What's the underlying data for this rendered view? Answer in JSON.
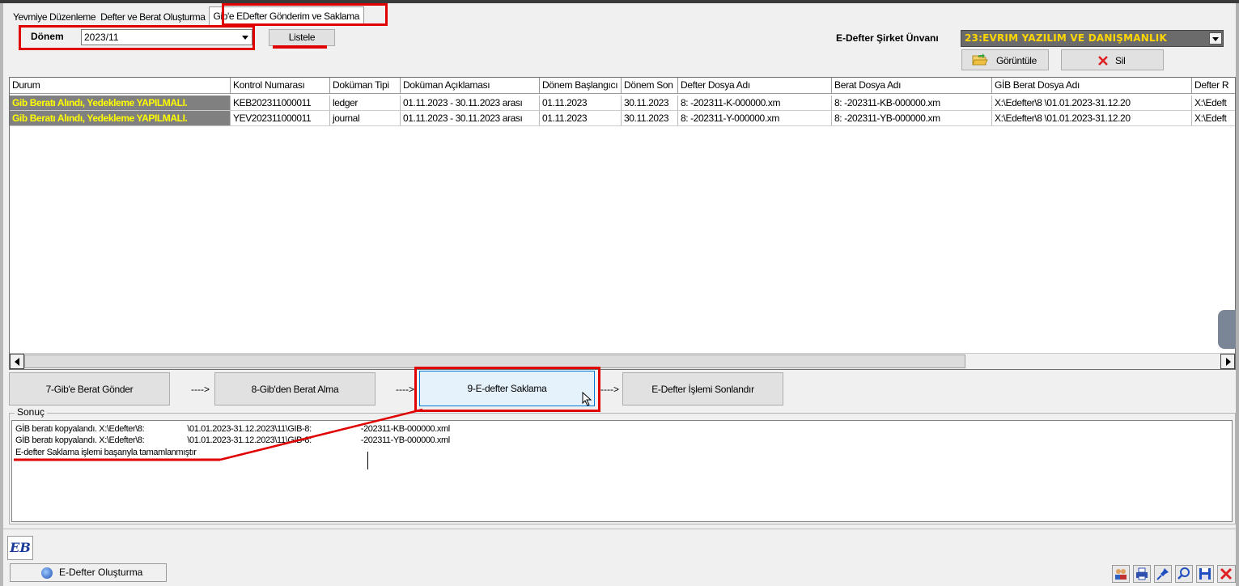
{
  "tabs": [
    {
      "label": "Yevmiye Düzenleme"
    },
    {
      "label": "Defter ve Berat Oluşturma"
    },
    {
      "label": "Gib'e EDefter Gönderim ve Saklama"
    }
  ],
  "filter": {
    "period_label": "Dönem",
    "period_value": "2023/11",
    "list_button": "Listele",
    "company_label": "E-Defter Şirket Ünvanı",
    "company_value": "23:EVRIM YAZILIM VE DANIŞMANLIK",
    "view_button": "Görüntüle",
    "delete_button": "Sil"
  },
  "table": {
    "columns": [
      "Durum",
      "Kontrol Numarası",
      "Doküman Tipi",
      "Doküman Açıklaması",
      "Dönem Başlangıcı",
      "Dönem Son",
      "Defter Dosya Adı",
      "Berat Dosya Adı",
      "GİB Berat Dosya Adı",
      "Defter R"
    ],
    "rows": [
      [
        "Gib Beratı Alındı, Yedekleme YAPILMALI.",
        "KEB202311000011",
        "ledger",
        "01.11.2023 - 30.11.2023 arası",
        "01.11.2023",
        "30.11.2023",
        "8:          -202311-K-000000.xm",
        "8:          -202311-KB-000000.xm",
        "X:\\Edefter\\8          \\01.01.2023-31.12.20",
        "X:\\Edeft"
      ],
      [
        "Gib Beratı Alındı, Yedekleme YAPILMALI.",
        "YEV202311000011",
        "journal",
        "01.11.2023 - 30.11.2023 arası",
        "01.11.2023",
        "30.11.2023",
        "8:          -202311-Y-000000.xm",
        "8:          -202311-YB-000000.xm",
        "X:\\Edefter\\8          \\01.01.2023-31.12.20",
        "X:\\Edeft"
      ]
    ]
  },
  "steps": {
    "step7": "7-Gib'e Berat Gönder",
    "step8": "8-Gib'den Berat Alma",
    "step9": "9-E-defter Saklama",
    "finish": "E-Defter İşlemi Sonlandır",
    "arrow": "---->"
  },
  "result": {
    "label": "Sonuç",
    "lines": [
      "GİB beratı kopyalandı. X:\\Edefter\\8:                    \\01.01.2023-31.12.2023\\11\\GIB-8:                       -202311-KB-000000.xml",
      "GİB beratı kopyalandı. X:\\Edefter\\8:                    \\01.01.2023-31.12.2023\\11\\GIB-8:                       -202311-YB-000000.xml",
      "E-defter Saklama işlemi başarıyla tamamlanmıştır"
    ]
  },
  "taskbar": {
    "app_button": "E-Defter Oluşturma",
    "logo_text": "EB"
  },
  "icons": [
    "open-folder-icon",
    "delete-x-icon",
    "eb-logo-icon",
    "app-globe-icon",
    "users-icon",
    "print-icon",
    "pin-icon",
    "search-icon",
    "save-icon",
    "close-icon"
  ],
  "colors": {
    "highlight_red": "#e00000",
    "status_bg": "#808080",
    "status_text": "#ffff00",
    "company_bg": "#6b6b6b",
    "company_text": "#ffd700",
    "active_step_bg": "#e5f1fb"
  }
}
